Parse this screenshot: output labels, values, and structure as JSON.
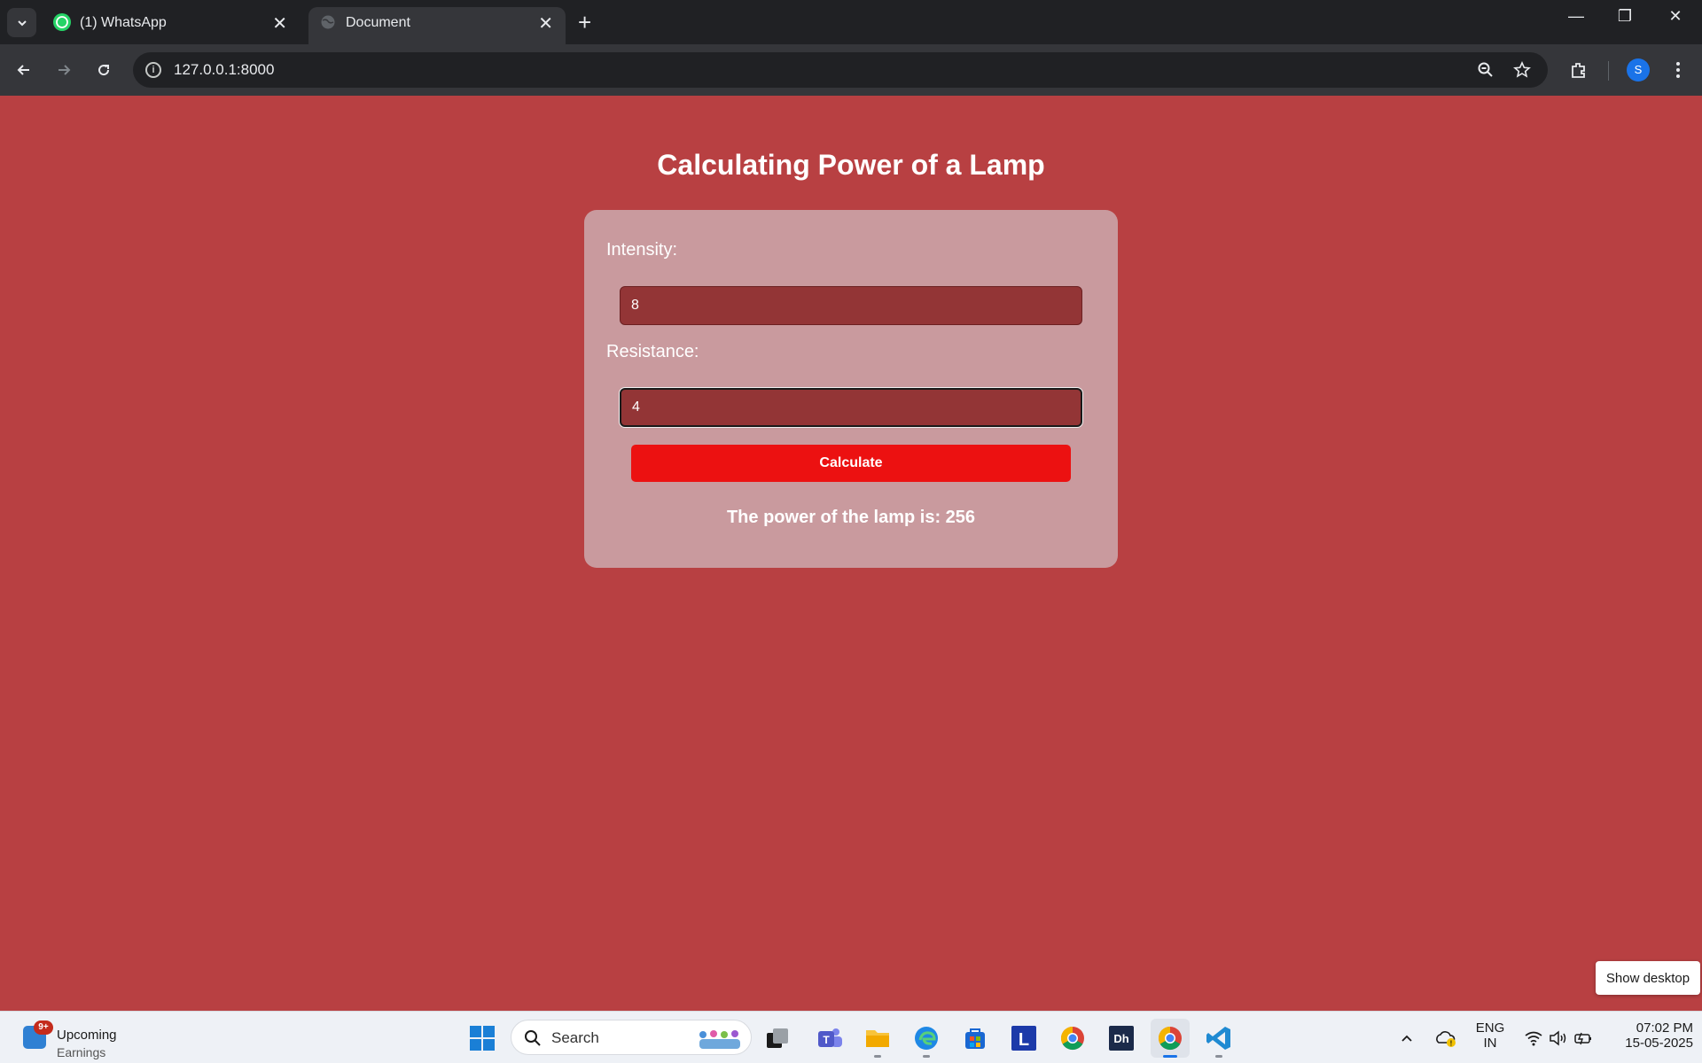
{
  "browser": {
    "tabs": [
      {
        "title": "(1) WhatsApp",
        "icon": "whatsapp-icon"
      },
      {
        "title": "Document",
        "icon": "globe-icon"
      }
    ],
    "url": "127.0.0.1:8000"
  },
  "page": {
    "title": "Calculating Power of a Lamp",
    "intensity_label": "Intensity:",
    "intensity_value": "8",
    "resistance_label": "Resistance:",
    "resistance_value": "4",
    "calculate_label": "Calculate",
    "result_text": "The power of the lamp is: 256",
    "background_color": "#b84042",
    "card_color": "#c99a9e",
    "button_color": "#ec1111"
  },
  "desktop": {
    "show_desktop_label": "Show desktop"
  },
  "taskbar": {
    "widget_badge": "9+",
    "widget_title": "Upcoming",
    "widget_subtitle": "Earnings",
    "search_label": "Search",
    "language_line1": "ENG",
    "language_line2": "IN",
    "time": "07:02 PM",
    "date": "15-05-2025",
    "profile_initial": "S"
  }
}
